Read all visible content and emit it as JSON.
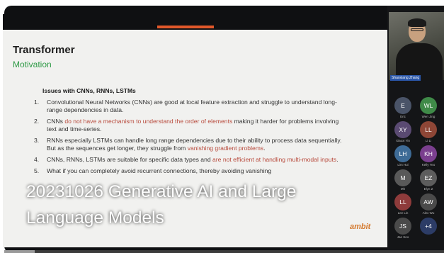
{
  "slide": {
    "title": "Transformer",
    "subtitle": "Motivation",
    "heading": "Issues with CNNs, RNNs, LSTMs",
    "items": [
      {
        "num": "1.",
        "parts": [
          {
            "text": "Convolutional Neural Networks (CNNs) are good at local feature extraction and struggle to understand long-range dependencies in data.",
            "style": "normal"
          }
        ]
      },
      {
        "num": "2.",
        "parts": [
          {
            "text": "CNNs ",
            "style": "normal"
          },
          {
            "text": "do not have a mechanism to understand the order of elements",
            "style": "red"
          },
          {
            "text": " making it harder for problems  involving text and time-series.",
            "style": "normal"
          }
        ]
      },
      {
        "num": "3.",
        "parts": [
          {
            "text": "RNNs especially LSTMs can handle long range dependencies due to their ability to process data  sequentially. But as the sequences get longer, they struggle from ",
            "style": "normal"
          },
          {
            "text": "vanishing gradient problems",
            "style": "red"
          },
          {
            "text": ".",
            "style": "normal"
          }
        ]
      },
      {
        "num": "4.",
        "parts": [
          {
            "text": "CNNs, RNNs, LSTMs are suitable for specific data types and ",
            "style": "normal"
          },
          {
            "text": "are not efficient at handling multi-modal inputs",
            "style": "red"
          },
          {
            "text": ".",
            "style": "normal"
          }
        ]
      },
      {
        "num": "5.",
        "parts": [
          {
            "text": "What if you can completely avoid recurrent connections, thereby avoiding vanishing",
            "style": "normal"
          }
        ]
      }
    ],
    "logo_text": "ambit"
  },
  "video_title": "20231026 Generative AI and Large Language Models",
  "speaker": {
    "name": "Shaoxiang Zhang"
  },
  "participants": [
    {
      "initials": "E",
      "name": "Eric",
      "color": "#4a5468"
    },
    {
      "initials": "WL",
      "name": "Wen Jing",
      "color": "#3f8a48"
    },
    {
      "initials": "XY",
      "name": "Xiaoxi Yin",
      "color": "#5a4a72"
    },
    {
      "initials": "LL",
      "name": "Li Li",
      "color": "#8e4636"
    },
    {
      "initials": "LH",
      "name": "Lim Hui",
      "color": "#3e6b96"
    },
    {
      "initials": "KH",
      "name": "Kelly Yeo",
      "color": "#7a3f8e"
    },
    {
      "initials": "M",
      "name": "Mh",
      "color": "#595959"
    },
    {
      "initials": "EZ",
      "name": "Elyn Z",
      "color": "#5d5d5d"
    },
    {
      "initials": "LL",
      "name": "Lee Lin",
      "color": "#8e3b3b"
    },
    {
      "initials": "AW",
      "name": "Alex Wu",
      "color": "#4a4a4a"
    },
    {
      "initials": "JS",
      "name": "Jae Seo",
      "color": "#4a4a4a"
    },
    {
      "initials": "+4",
      "name": "",
      "color": "#2c3c66"
    }
  ],
  "playback": {
    "progress": 0.07
  },
  "colors": {
    "accent": "#e1582a",
    "subtitle_green": "#2e9a46",
    "emphasis_red": "#b84a3c"
  }
}
